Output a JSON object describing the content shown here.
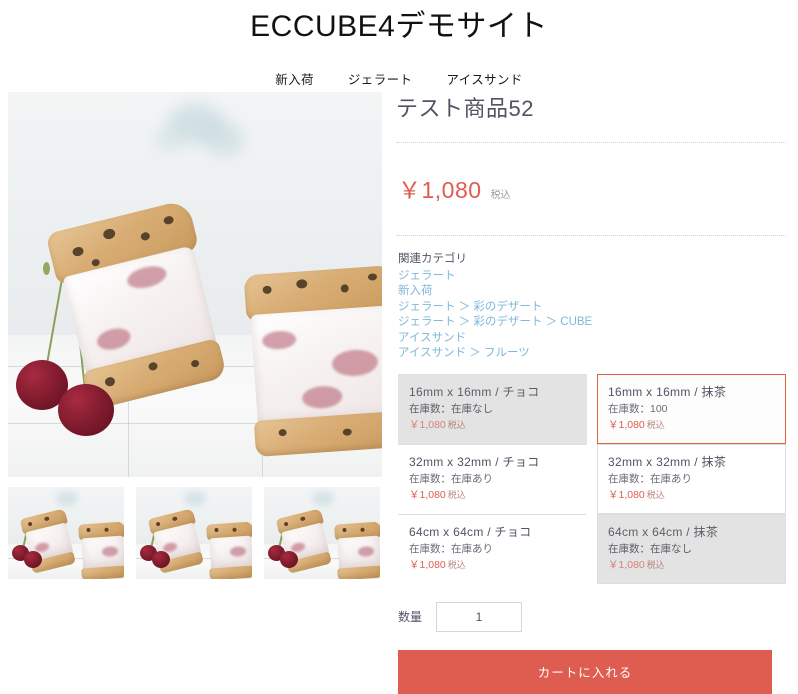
{
  "header": {
    "site_title": "ECCUBE4デモサイト",
    "nav": [
      {
        "label": "新入荷"
      },
      {
        "label": "ジェラート"
      },
      {
        "label": "アイスサンド"
      }
    ]
  },
  "product": {
    "name": "テスト商品52",
    "price": "￥1,080",
    "price_tax_label": "税込",
    "category_label": "関連カテゴリ",
    "categories": [
      {
        "text": "ジェラート"
      },
      {
        "text": "新入荷"
      },
      {
        "text": "ジェラート ＞ 彩のデザート"
      },
      {
        "text": "ジェラート ＞ 彩のデザート ＞ CUBE"
      },
      {
        "text": "アイスサンド"
      },
      {
        "text": "アイスサンド ＞ フルーツ"
      }
    ],
    "variants": [
      {
        "name": "16mm x 16mm / チョコ",
        "stock": "在庫数：在庫なし",
        "price": "￥1,080",
        "tax": "税込",
        "selected": false,
        "disabled": true,
        "boxed": false
      },
      {
        "name": "16mm x 16mm / 抹茶",
        "stock": "在庫数：100",
        "price": "￥1,080",
        "tax": "税込",
        "selected": true,
        "disabled": false,
        "boxed": true
      },
      {
        "name": "32mm x 32mm / チョコ",
        "stock": "在庫数：在庫あり",
        "price": "￥1,080",
        "tax": "税込",
        "selected": false,
        "disabled": false,
        "boxed": false
      },
      {
        "name": "32mm x 32mm / 抹茶",
        "stock": "在庫数：在庫あり",
        "price": "￥1,080",
        "tax": "税込",
        "selected": false,
        "disabled": false,
        "boxed": true
      },
      {
        "name": "64cm x 64cm / チョコ",
        "stock": "在庫数：在庫あり",
        "price": "￥1,080",
        "tax": "税込",
        "selected": false,
        "disabled": false,
        "boxed": false
      },
      {
        "name": "64cm x 64cm / 抹茶",
        "stock": "在庫数：在庫なし",
        "price": "￥1,080",
        "tax": "税込",
        "selected": false,
        "disabled": true,
        "boxed": true
      }
    ],
    "quantity_label": "数量",
    "quantity_value": "1",
    "cart_button_label": "カートに入れる"
  },
  "gallery": {
    "main_image_alt": "アイスサンドとチェリーの商品写真",
    "thumbnails": [
      {
        "alt": "商品サムネイル1"
      },
      {
        "alt": "商品サムネイル2"
      },
      {
        "alt": "商品サムネイル3"
      }
    ]
  },
  "colors": {
    "accent": "#DE5D50",
    "selected_border": "#E0603F",
    "link": "#7fb8d8",
    "text": "#525263"
  }
}
